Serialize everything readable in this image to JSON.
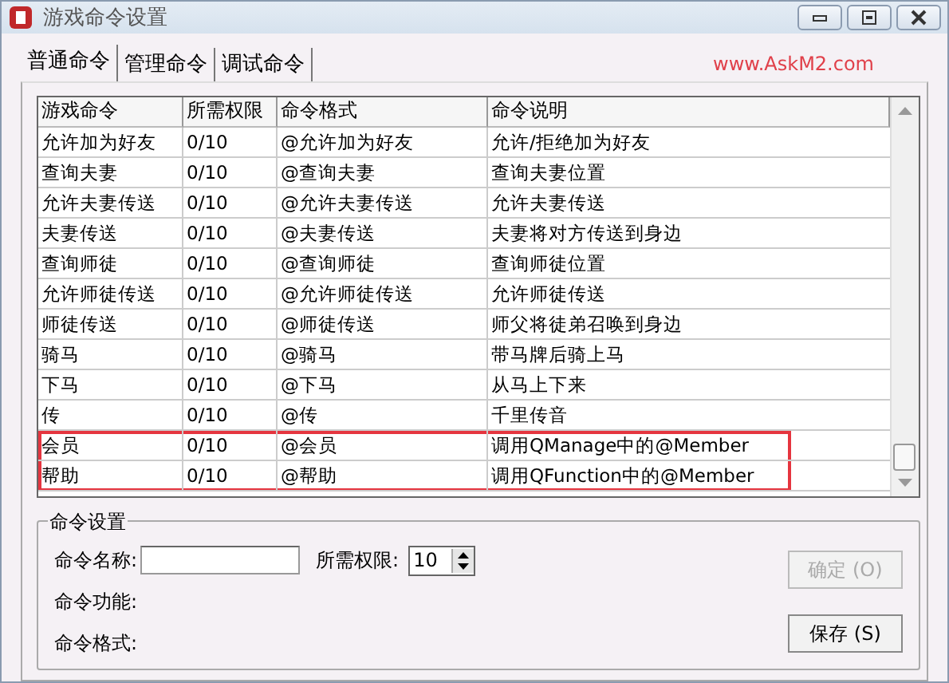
{
  "window": {
    "title": "游戏命令设置"
  },
  "tabs": [
    {
      "label": "普通命令",
      "selected": true
    },
    {
      "label": "管理命令",
      "selected": false
    },
    {
      "label": "调试命令",
      "selected": false
    }
  ],
  "watermark_link": "www.AskM2.com",
  "table": {
    "columns": [
      "游戏命令",
      "所需权限",
      "命令格式",
      "命令说明"
    ],
    "rows": [
      {
        "cells": [
          "允许加为好友",
          "0/10",
          "@允许加为好友",
          "允许/拒绝加为好友"
        ],
        "highlighted": false
      },
      {
        "cells": [
          "查询夫妻",
          "0/10",
          "@查询夫妻",
          "查询夫妻位置"
        ],
        "highlighted": false
      },
      {
        "cells": [
          "允许夫妻传送",
          "0/10",
          "@允许夫妻传送",
          "允许夫妻传送"
        ],
        "highlighted": false
      },
      {
        "cells": [
          "夫妻传送",
          "0/10",
          "@夫妻传送",
          "夫妻将对方传送到身边"
        ],
        "highlighted": false
      },
      {
        "cells": [
          "查询师徒",
          "0/10",
          "@查询师徒",
          "查询师徒位置"
        ],
        "highlighted": false
      },
      {
        "cells": [
          "允许师徒传送",
          "0/10",
          "@允许师徒传送",
          "允许师徒传送"
        ],
        "highlighted": false
      },
      {
        "cells": [
          "师徒传送",
          "0/10",
          "@师徒传送",
          "师父将徒弟召唤到身边"
        ],
        "highlighted": false
      },
      {
        "cells": [
          "骑马",
          "0/10",
          "@骑马",
          "带马牌后骑上马"
        ],
        "highlighted": false
      },
      {
        "cells": [
          "下马",
          "0/10",
          "@下马",
          "从马上下来"
        ],
        "highlighted": false
      },
      {
        "cells": [
          "传",
          "0/10",
          "@传",
          "千里传音"
        ],
        "highlighted": false
      },
      {
        "cells": [
          "会员",
          "0/10",
          "@会员",
          "调用QManage中的@Member"
        ],
        "highlighted": true
      },
      {
        "cells": [
          "帮助",
          "0/10",
          "@帮助",
          "调用QFunction中的@Member"
        ],
        "highlighted": true
      }
    ]
  },
  "settings": {
    "title": "命令设置",
    "name_label": "命令名称:",
    "permission_label": "所需权限:",
    "permission_value": "10",
    "function_label": "命令功能:",
    "format_label": "命令格式:",
    "buttons": [
      {
        "label": "确定 (O)",
        "disabled": true
      },
      {
        "label": "保存 (S)",
        "disabled": false
      }
    ]
  }
}
